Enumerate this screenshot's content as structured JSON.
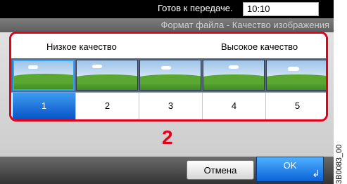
{
  "status": {
    "message": "Готов к передаче.",
    "time": "10:10"
  },
  "title": "Формат файла - Качество изображения",
  "quality": {
    "low_label": "Низкое качество",
    "high_label": "Высокое качество",
    "levels": [
      "1",
      "2",
      "3",
      "4",
      "5"
    ],
    "selected": "1"
  },
  "callout": "2",
  "footer": {
    "cancel_label": "Отмена",
    "ok_label": "OK",
    "enter_icon": "enter-icon"
  },
  "image_code": "3B0083_00",
  "colors": {
    "highlight": "#e3001b",
    "selected_fill": "#0753c8",
    "ok_fill": "#0a63d6"
  }
}
